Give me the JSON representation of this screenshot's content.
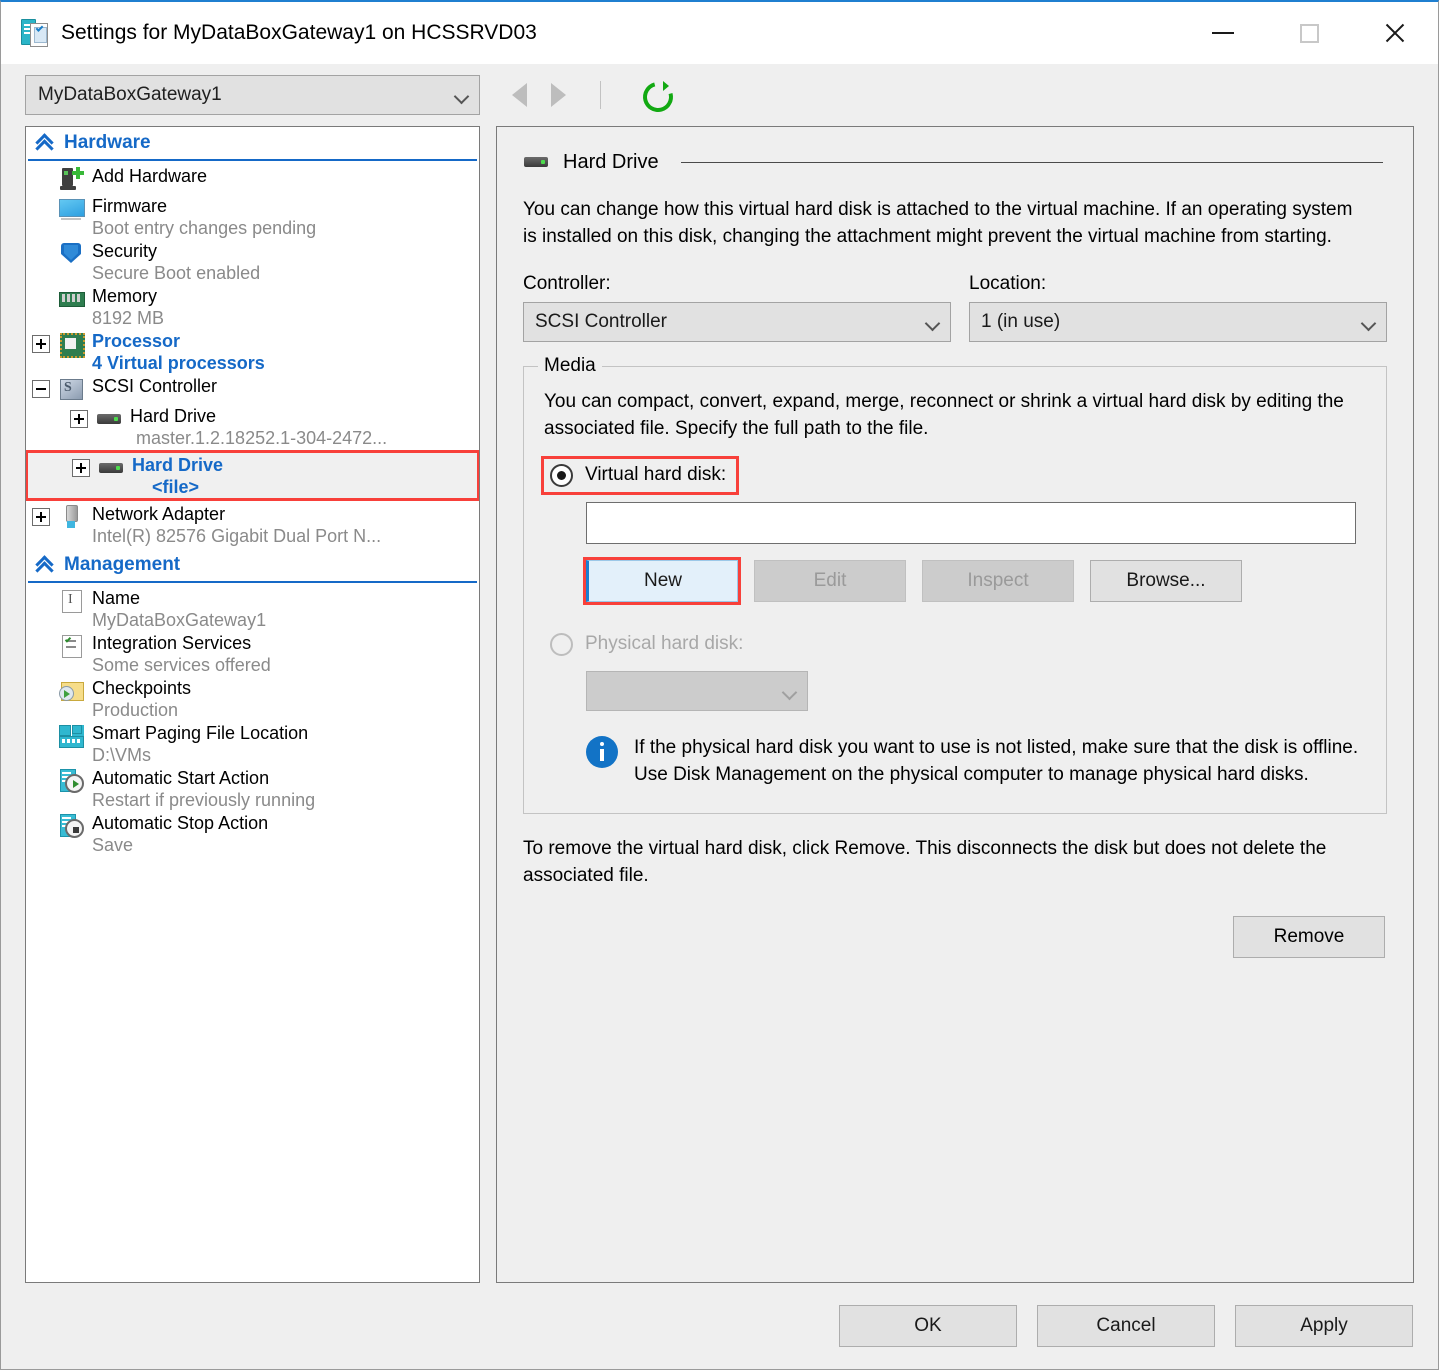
{
  "window": {
    "title": "Settings for MyDataBoxGateway1 on HCSSRVD03",
    "icon": "settings-vm-icon",
    "controls": {
      "minimize": "–",
      "maximize": "□",
      "close": "✕"
    }
  },
  "toolbar": {
    "vm_selector_value": "MyDataBoxGateway1",
    "back_icon": "arrow-left-icon",
    "forward_icon": "arrow-right-icon",
    "refresh_icon": "refresh-icon"
  },
  "sidebar": {
    "sections": [
      {
        "title": "Hardware",
        "items": [
          {
            "label": "Add Hardware",
            "sub": "",
            "icon": "add-hardware-icon",
            "expander": "none",
            "indent": 0,
            "highlight": false,
            "blue": false
          },
          {
            "label": "Firmware",
            "sub": "Boot entry changes pending",
            "icon": "firmware-icon",
            "expander": "none",
            "indent": 0,
            "highlight": false,
            "blue": false
          },
          {
            "label": "Security",
            "sub": "Secure Boot enabled",
            "icon": "shield-icon",
            "expander": "none",
            "indent": 0,
            "highlight": false,
            "blue": false
          },
          {
            "label": "Memory",
            "sub": "8192 MB",
            "icon": "memory-icon",
            "expander": "none",
            "indent": 0,
            "highlight": false,
            "blue": false
          },
          {
            "label": "Processor",
            "sub": "4 Virtual processors",
            "icon": "processor-icon",
            "expander": "plus",
            "indent": 0,
            "highlight": false,
            "blue": true
          },
          {
            "label": "SCSI Controller",
            "sub": "",
            "icon": "scsi-controller-icon",
            "expander": "minus",
            "indent": 0,
            "highlight": false,
            "blue": false
          },
          {
            "label": "Hard Drive",
            "sub": "master.1.2.18252.1-304-2472...",
            "icon": "hard-drive-icon",
            "expander": "plus",
            "indent": 1,
            "highlight": false,
            "blue": false
          },
          {
            "label": "Hard Drive",
            "sub": "<file>",
            "icon": "hard-drive-icon",
            "expander": "plus",
            "indent": 1,
            "highlight": true,
            "blue": true
          },
          {
            "label": "Network Adapter",
            "sub": "Intel(R) 82576 Gigabit Dual Port N...",
            "icon": "network-adapter-icon",
            "expander": "plus",
            "indent": 0,
            "highlight": false,
            "blue": false
          }
        ]
      },
      {
        "title": "Management",
        "items": [
          {
            "label": "Name",
            "sub": "MyDataBoxGateway1",
            "icon": "name-icon",
            "expander": "none",
            "indent": 0,
            "highlight": false,
            "blue": false
          },
          {
            "label": "Integration Services",
            "sub": "Some services offered",
            "icon": "integration-services-icon",
            "expander": "none",
            "indent": 0,
            "highlight": false,
            "blue": false
          },
          {
            "label": "Checkpoints",
            "sub": "Production",
            "icon": "checkpoints-icon",
            "expander": "none",
            "indent": 0,
            "highlight": false,
            "blue": false
          },
          {
            "label": "Smart Paging File Location",
            "sub": "D:\\VMs",
            "icon": "smart-paging-icon",
            "expander": "none",
            "indent": 0,
            "highlight": false,
            "blue": false
          },
          {
            "label": "Automatic Start Action",
            "sub": "Restart if previously running",
            "icon": "automatic-start-icon",
            "expander": "none",
            "indent": 0,
            "highlight": false,
            "blue": false
          },
          {
            "label": "Automatic Stop Action",
            "sub": "Save",
            "icon": "automatic-stop-icon",
            "expander": "none",
            "indent": 0,
            "highlight": false,
            "blue": false
          }
        ]
      }
    ]
  },
  "panel": {
    "header_title": "Hard Drive",
    "header_icon": "hard-drive-icon",
    "description": "You can change how this virtual hard disk is attached to the virtual machine. If an operating system is installed on this disk, changing the attachment might prevent the virtual machine from starting.",
    "controller_label": "Controller:",
    "controller_value": "SCSI Controller",
    "location_label": "Location:",
    "location_value": "1 (in use)",
    "media": {
      "legend": "Media",
      "description": "You can compact, convert, expand, merge, reconnect or shrink a virtual hard disk by editing the associated file. Specify the full path to the file.",
      "virtual_radio_label": "Virtual hard disk:",
      "virtual_radio_selected": true,
      "path_value": "",
      "buttons": {
        "new": "New",
        "edit": "Edit",
        "inspect": "Inspect",
        "browse": "Browse..."
      },
      "physical_radio_label": "Physical hard disk:",
      "physical_radio_selected": false,
      "physical_combo_value": "",
      "info_icon": "info-icon",
      "info_text": "If the physical hard disk you want to use is not listed, make sure that the disk is offline. Use Disk Management on the physical computer to manage physical hard disks."
    },
    "remove_description": "To remove the virtual hard disk, click Remove. This disconnects the disk but does not delete the associated file.",
    "remove_button": "Remove"
  },
  "footer": {
    "ok": "OK",
    "cancel": "Cancel",
    "apply": "Apply"
  },
  "colors": {
    "accent_blue": "#1569c7",
    "highlight_red": "#f8403a",
    "title_bar_blue": "#1f7fd0"
  }
}
